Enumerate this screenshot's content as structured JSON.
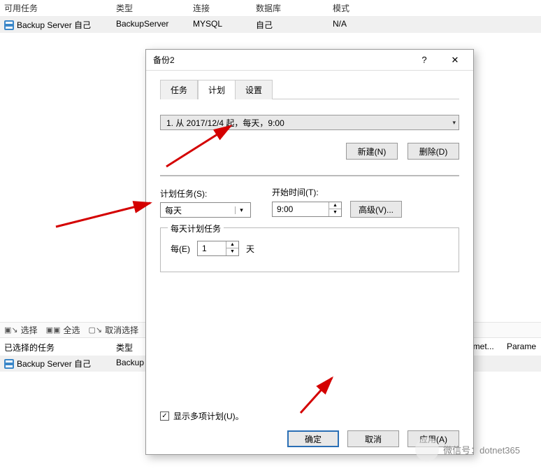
{
  "bg": {
    "headers": [
      "可用任务",
      "类型",
      "连接",
      "数据库",
      "模式"
    ],
    "row": {
      "task": "Backup Server 自己",
      "type": "BackupServer",
      "conn": "MYSQL",
      "db": "自己",
      "mode": "N/A"
    }
  },
  "toolbar": {
    "select": "选择",
    "selectAll": "全选",
    "cancelSelect": "取消选择"
  },
  "sel": {
    "header1": "已选择的任务",
    "header2": "类型",
    "header3": "amet...",
    "header4": "Parame",
    "row": {
      "task": "Backup Server 自己",
      "type": "Backup"
    }
  },
  "dlg": {
    "title": "备份2",
    "tabs": {
      "task": "任务",
      "plan": "计划",
      "settings": "设置"
    },
    "schedule_text": "1. 从 2017/12/4 起，每天，9:00",
    "btn_new": "新建(N)",
    "btn_delete": "删除(D)",
    "lbl_plan": "计划任务(S):",
    "lbl_start": "开始时间(T):",
    "val_plan": "每天",
    "val_start": "9:00",
    "btn_adv": "高级(V)...",
    "group_title": "每天计划任务",
    "lbl_every": "每(E)",
    "val_every": "1",
    "lbl_unit": "天",
    "chk_label": "显示多项计划(U)。",
    "btn_ok": "确定",
    "btn_cancel": "取消",
    "btn_apply": "应用(A)"
  },
  "wm": "微信号：dotnet365"
}
